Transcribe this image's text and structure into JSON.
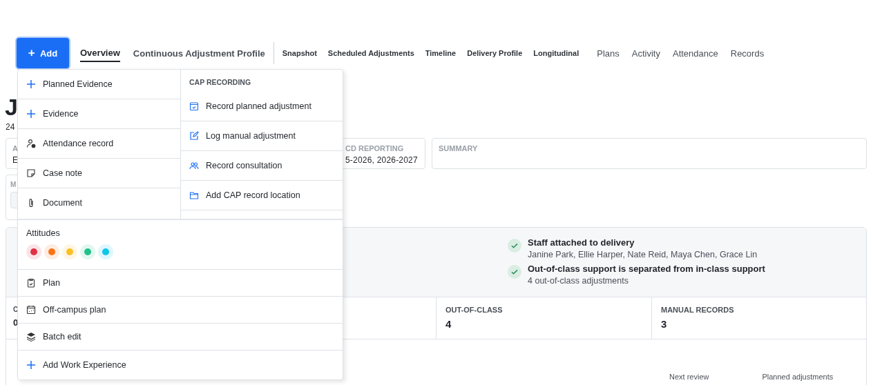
{
  "add_button": {
    "label": "Add",
    "icon": "+"
  },
  "tabs": [
    {
      "label": "Overview",
      "selected": true,
      "kind": "primary"
    },
    {
      "label": "Continuous Adjustment Profile",
      "selected": false,
      "kind": "primary"
    },
    {
      "label": "Snapshot",
      "selected": false,
      "kind": "compact"
    },
    {
      "label": "Scheduled Adjustments",
      "selected": false,
      "kind": "compact"
    },
    {
      "label": "Timeline",
      "selected": false,
      "kind": "compact"
    },
    {
      "label": "Delivery Profile",
      "selected": false,
      "kind": "compact"
    },
    {
      "label": "Longitudinal",
      "selected": false,
      "kind": "compact"
    },
    {
      "label": "Plans",
      "selected": false,
      "kind": "secondary"
    },
    {
      "label": "Activity",
      "selected": false,
      "kind": "secondary"
    },
    {
      "label": "Attendance",
      "selected": false,
      "kind": "secondary"
    },
    {
      "label": "Records",
      "selected": false,
      "kind": "secondary"
    }
  ],
  "page": {
    "heading": "J",
    "subheading": "24",
    "cards": [
      {
        "label": "A",
        "value": "E"
      },
      {
        "label": "CD REPORTING",
        "value": "5-2026, 2026-2027"
      },
      {
        "label": "SUMMARY"
      }
    ],
    "card_m": {
      "label": "M"
    },
    "checks": [
      {
        "title": "Staff attached to delivery",
        "detail": "Janine Park, Ellie Harper, Nate Reid, Maya Chen, Grace Lin"
      },
      {
        "title": "Out-of-class support is separated from in-class support",
        "detail": "4 out-of-class adjustments"
      }
    ],
    "stats": [
      {
        "label": "C",
        "value": "0"
      },
      {
        "label": "OUT-OF-CLASS",
        "value": "4"
      },
      {
        "label": "MANUAL RECORDS",
        "value": "3"
      }
    ],
    "next_review": {
      "label": "Next review"
    },
    "planned": {
      "label": "Planned adjustments"
    }
  },
  "add_menu": {
    "left_items": [
      {
        "label": "Planned Evidence"
      },
      {
        "label": "Evidence"
      },
      {
        "label": "Attendance record"
      },
      {
        "label": "Case note"
      },
      {
        "label": "Document"
      }
    ],
    "section_title": "CAP RECORDING",
    "right_items": [
      {
        "label": "Record planned adjustment"
      },
      {
        "label": "Log manual adjustment"
      },
      {
        "label": "Record consultation"
      },
      {
        "label": "Add CAP record location"
      }
    ],
    "attitudes": {
      "label": "Attitudes",
      "dots": [
        {
          "color": "#e03145"
        },
        {
          "color": "#f97316"
        },
        {
          "color": "#fbbf24"
        },
        {
          "color": "#22c08a"
        },
        {
          "color": "#0ec5ea"
        }
      ]
    },
    "items": [
      {
        "label": "Plan"
      },
      {
        "label": "Off-campus plan"
      },
      {
        "label": "Batch edit"
      },
      {
        "label": "Add Work Experience"
      }
    ]
  }
}
